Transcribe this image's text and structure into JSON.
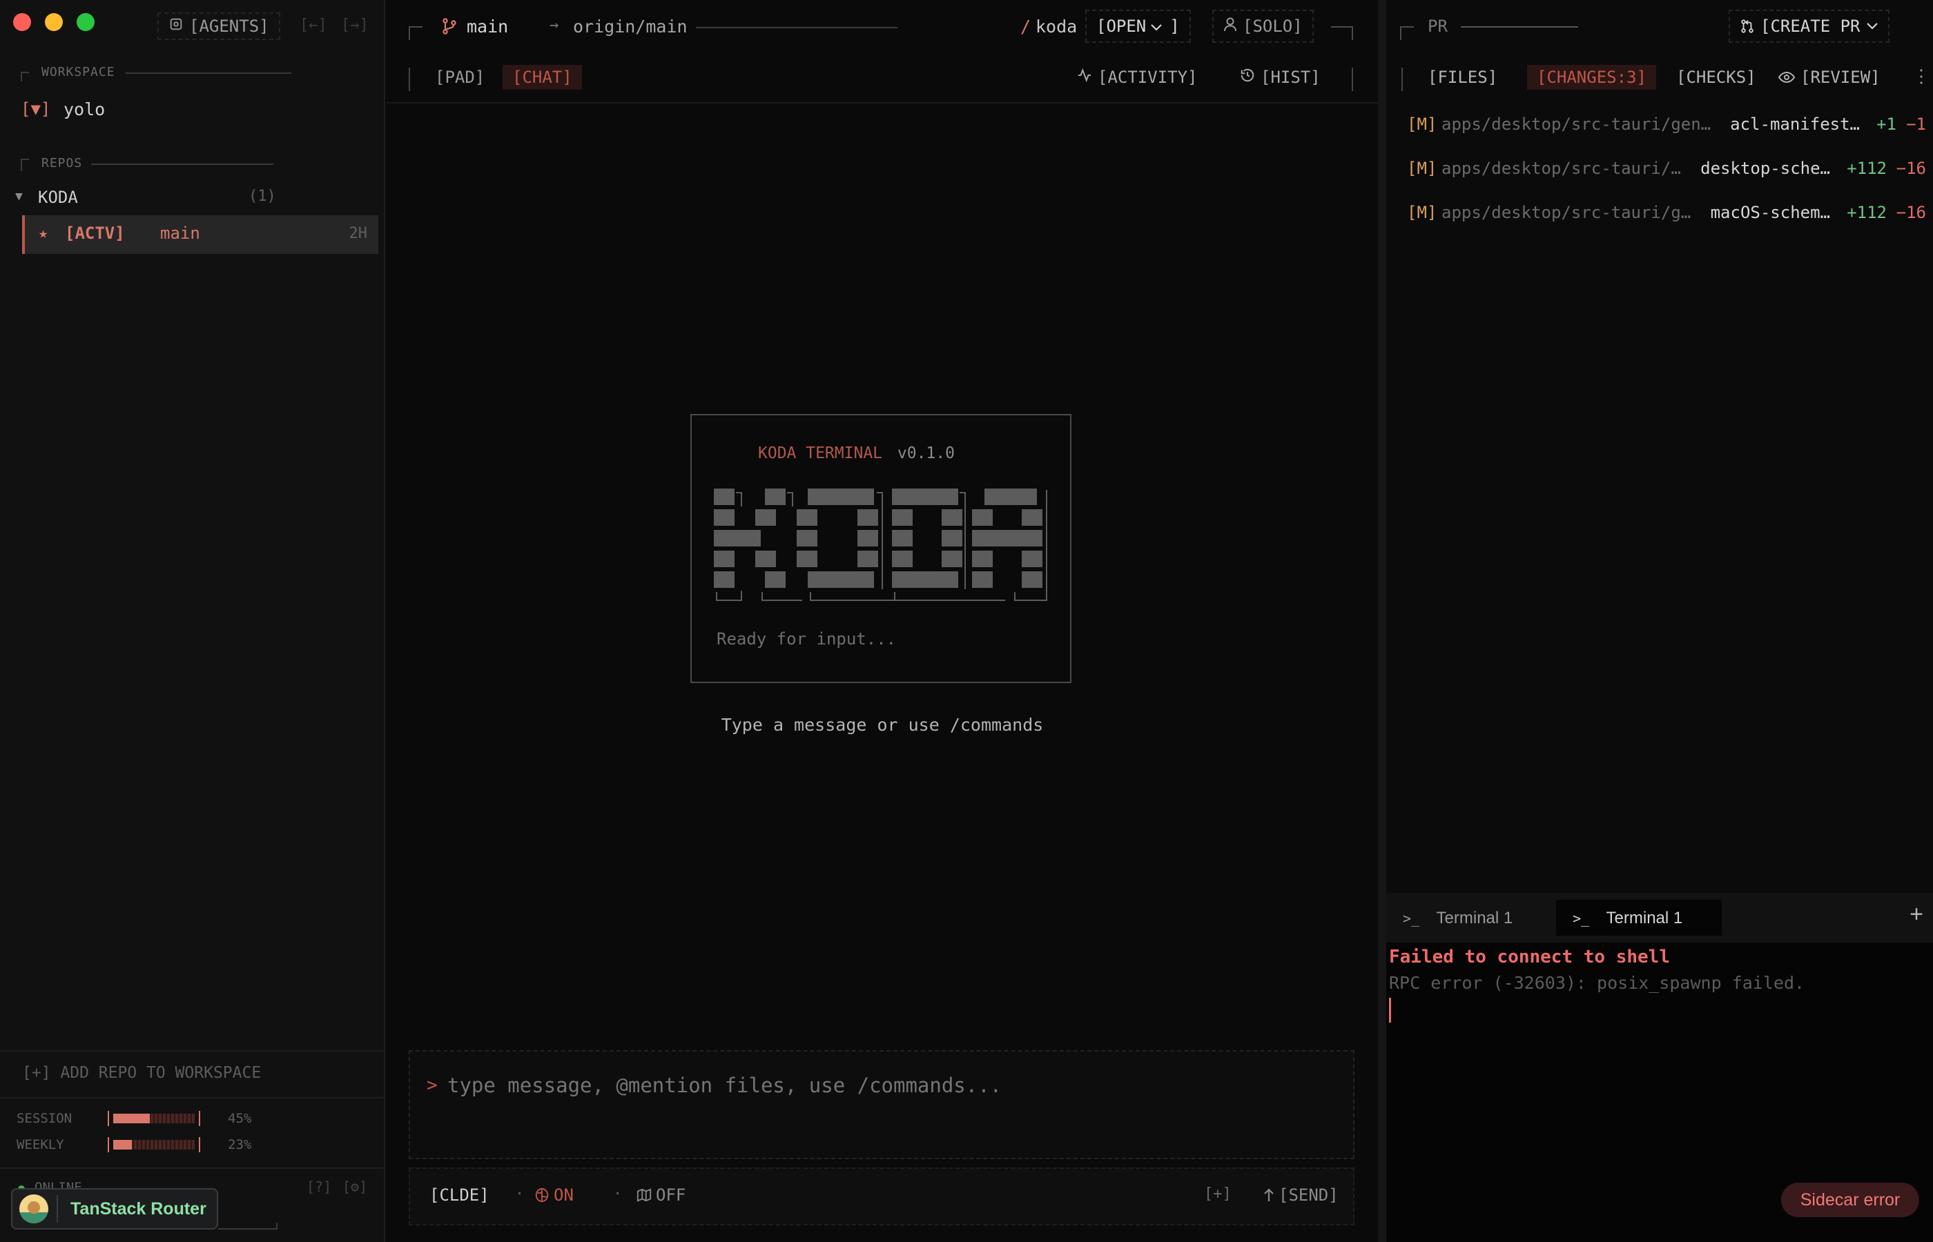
{
  "window": {
    "agents_label": "[AGENTS]",
    "nav_back": "[←]",
    "nav_forward": "[→]"
  },
  "sidebar": {
    "workspace_label": "WORKSPACE",
    "workspace_toggle": "[▼]",
    "workspace_name": "yolo",
    "repos_label": "REPOS",
    "repo": {
      "name": "KODA",
      "count": "(1)"
    },
    "branch": {
      "star": "★",
      "tag": "[ACTV]",
      "name": "main",
      "age": "2H"
    },
    "add_repo": "[+] ADD REPO TO WORKSPACE",
    "usage": [
      {
        "label": "SESSION",
        "percent": 45,
        "text": "45%"
      },
      {
        "label": "WEEKLY",
        "percent": 23,
        "text": "23%"
      }
    ],
    "status": "ONLINE",
    "help": "[?]",
    "settings": "[⚙]"
  },
  "header": {
    "branch": "main",
    "remote": "origin/main",
    "project_slash": "/",
    "project": "koda",
    "open_button": "[OPEN",
    "open_close": "]",
    "solo_button": "[SOLO]"
  },
  "center_tabs": {
    "pad": "[PAD]",
    "chat": "[CHAT]",
    "activity": "[ACTIVITY]",
    "history": "[HIST]"
  },
  "splash": {
    "title": "KODA TERMINAL",
    "version": "v0.1.0",
    "logo_text": "KODA",
    "status": "Ready for input...",
    "hint": "Type a message or use /commands"
  },
  "composer": {
    "prompt": ">",
    "placeholder": "type message, @mention files, use /commands..."
  },
  "footer": {
    "model": "[CLDE]",
    "sep": "·",
    "web_on": "ON",
    "map_off": "OFF",
    "add": "[+]",
    "send": "[SEND]"
  },
  "right_panel": {
    "pr_label": "PR",
    "create_pr": "[CREATE PR",
    "tabs": {
      "files": "[FILES]",
      "changes": "[CHANGES:3]",
      "checks": "[CHECKS]",
      "review": "[REVIEW]"
    },
    "files": [
      {
        "status": "[M]",
        "path": "apps/desktop/src-tauri/gen…",
        "name": "acl-manifest…",
        "added": "+1",
        "removed": "−1"
      },
      {
        "status": "[M]",
        "path": "apps/desktop/src-tauri/…",
        "name": "desktop-sche…",
        "added": "+112",
        "removed": "−16"
      },
      {
        "status": "[M]",
        "path": "apps/desktop/src-tauri/g…",
        "name": "macOS-schem…",
        "added": "+112",
        "removed": "−16"
      }
    ]
  },
  "terminal": {
    "tabs": [
      "Terminal 1",
      "Terminal 1"
    ],
    "add": "+",
    "error_title": "Failed to connect to shell",
    "error_detail": "RPC error (-32603): posix_spawnp failed."
  },
  "toasts": {
    "router": "TanStack Router",
    "sidecar": "Sidecar error"
  },
  "colors": {
    "accent": "#d9786a",
    "chat_tab": "#c0564a",
    "added": "#6fc28a",
    "removed": "#e06b6b",
    "modified": "#d9a05a",
    "error": "#ee6b6b"
  }
}
